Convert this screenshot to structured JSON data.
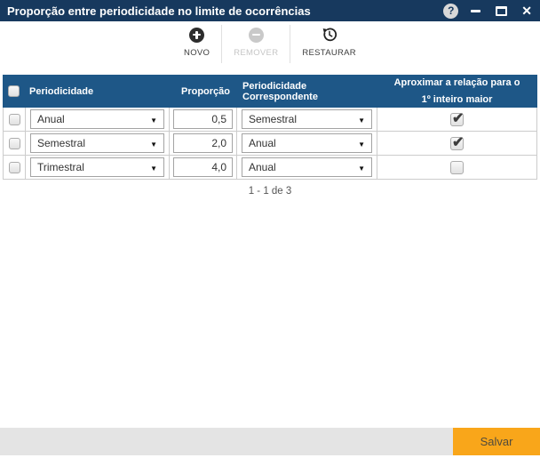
{
  "window": {
    "title": "Proporção entre periodicidade no limite de ocorrências",
    "help_glyph": "?",
    "close_glyph": "✕"
  },
  "toolbar": {
    "novo_label": "NOVO",
    "remover_label": "REMOVER",
    "restaurar_label": "RESTAURAR"
  },
  "table": {
    "headers": {
      "periodicidade": "Periodicidade",
      "proporcao": "Proporção",
      "correspondente": "Periodicidade Correspondente",
      "aproximar": "Aproximar a relação para o 1º inteiro maior"
    },
    "rows": [
      {
        "periodicidade": "Anual",
        "proporcao": "0,5",
        "correspondente": "Semestral",
        "aproximar": true,
        "selected": false
      },
      {
        "periodicidade": "Semestral",
        "proporcao": "2,0",
        "correspondente": "Anual",
        "aproximar": true,
        "selected": false
      },
      {
        "periodicidade": "Trimestral",
        "proporcao": "4,0",
        "correspondente": "Anual",
        "aproximar": false,
        "selected": false
      }
    ],
    "pagination": "1 - 1 de 3"
  },
  "footer": {
    "save_label": "Salvar"
  },
  "colors": {
    "titlebar": "#17395E",
    "table_header": "#1E5787",
    "accent_orange": "#F9A61A"
  }
}
